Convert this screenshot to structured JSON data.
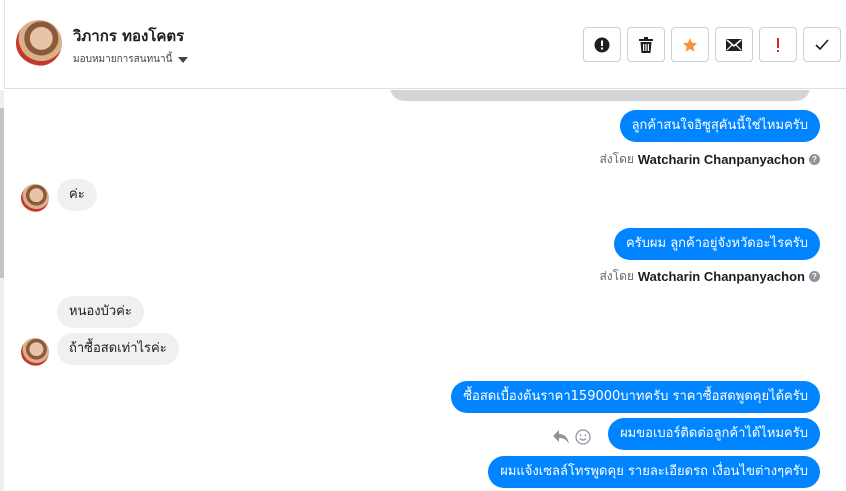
{
  "header": {
    "contact_name": "วิภากร ทองโคตร",
    "assign_label": "มอบหมายการสนทนานี้",
    "actions": [
      {
        "icon": "alert-circle-icon",
        "color": "#1c1e21"
      },
      {
        "icon": "trash-icon",
        "color": "#1c1e21"
      },
      {
        "icon": "star-icon",
        "color": "#f7923a"
      },
      {
        "icon": "envelope-icon",
        "color": "#1c1e21"
      },
      {
        "icon": "exclamation-icon",
        "color": "#e02424"
      },
      {
        "icon": "checkmark-icon",
        "color": "#1c1e21"
      }
    ]
  },
  "messages": {
    "m1": "ลูกค้าสนใจอิซูสุคันนี้ใช่ไหมครับ",
    "sent_by_1_prefix": "ส่งโดย",
    "sent_by_1_name": "Watcharin Chanpanyachon",
    "m2": "ค่ะ",
    "m3": "ครับผม ลูกค้าอยู่จังหวัดอะไรครับ",
    "sent_by_2_prefix": "ส่งโดย",
    "sent_by_2_name": "Watcharin Chanpanyachon",
    "m4": "หนองบัวค่ะ",
    "m5": "ถ้าซื้อสดเท่าไรค่ะ",
    "m6": "ซื้อสดเบื้องต้นราคา159000บาทครับ ราคาซื้อสดพูดคุยได้ครับ",
    "m7": "ผมขอเบอร์ติดต่อลูกค้าได้ไหมครับ",
    "m8": "ผมแจ้งเซลล์โทรพูดคุย รายละเอียดรถ เงื่อนไขต่างๆครับ"
  },
  "colors": {
    "outgoing_bubble": "#0084ff",
    "incoming_bubble": "#f1f0f0"
  }
}
